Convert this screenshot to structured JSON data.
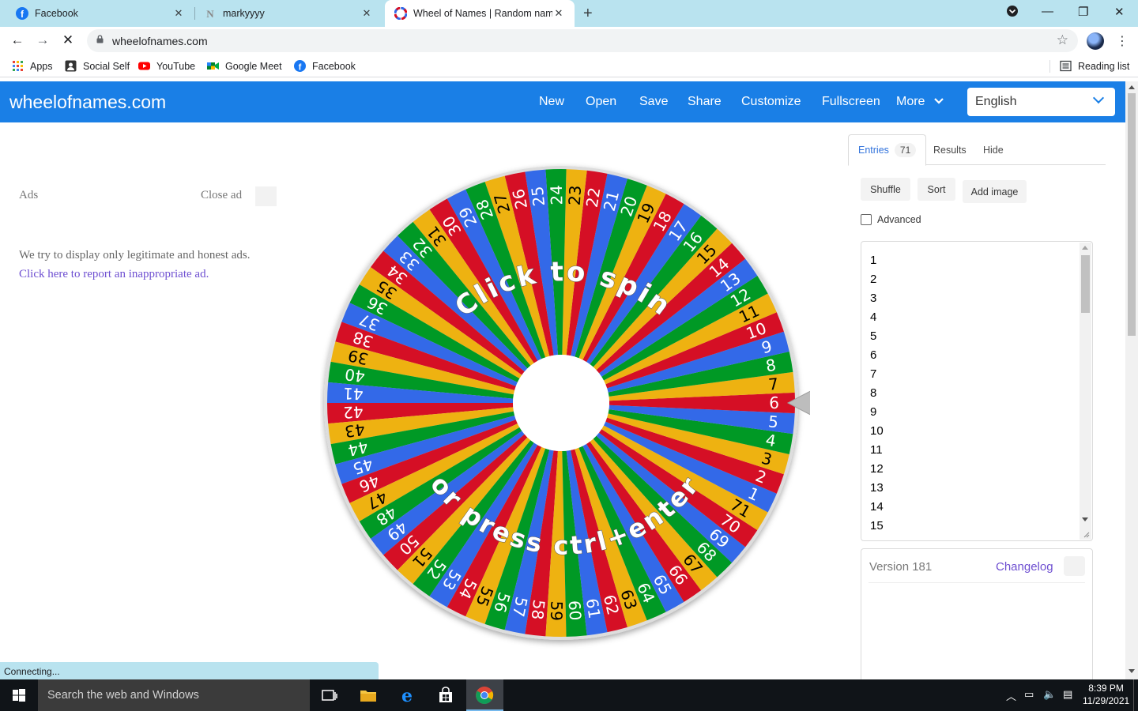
{
  "browser": {
    "tabs": [
      {
        "title": "Facebook",
        "favicon": "facebook-icon"
      },
      {
        "title": "markyyyy",
        "favicon": "n-logo-icon"
      },
      {
        "title": "Wheel of Names | Random name",
        "favicon": "wheel-icon"
      }
    ],
    "url": "wheelofnames.com",
    "bookmarks": [
      "Apps",
      "Social Self",
      "YouTube",
      "Google Meet",
      "Facebook"
    ],
    "reading_list": "Reading list",
    "status": "Connecting..."
  },
  "site": {
    "brand": "wheelofnames.com",
    "menu": [
      "New",
      "Open",
      "Save",
      "Share",
      "Customize",
      "Fullscreen",
      "More"
    ],
    "language": "English",
    "accent": "#1a7fe6"
  },
  "ads": {
    "label": "Ads",
    "close": "Close ad",
    "text": "We try to display only legitimate and honest ads.",
    "report_link": "Click here to report an inappropriate ad."
  },
  "wheel": {
    "entry_count": 71,
    "pointer_entry": "6",
    "top_text": "Click to spin",
    "bottom_text": "or press ctrl+enter",
    "colors": [
      "#3369e8",
      "#d50f25",
      "#eeb211",
      "#009925"
    ]
  },
  "panel": {
    "tabs": {
      "entries": "Entries",
      "entries_count": "71",
      "results": "Results",
      "hide": "Hide"
    },
    "buttons": {
      "shuffle": "Shuffle",
      "sort": "Sort",
      "add_image": "Add image"
    },
    "advanced": "Advanced",
    "entries": [
      "1",
      "2",
      "3",
      "4",
      "5",
      "6",
      "7",
      "8",
      "9",
      "10",
      "11",
      "12",
      "13",
      "14",
      "15"
    ],
    "version": "Version 181",
    "changelog": "Changelog"
  },
  "taskbar": {
    "search_placeholder": "Search the web and Windows",
    "time": "8:39 PM",
    "date": "11/29/2021"
  }
}
